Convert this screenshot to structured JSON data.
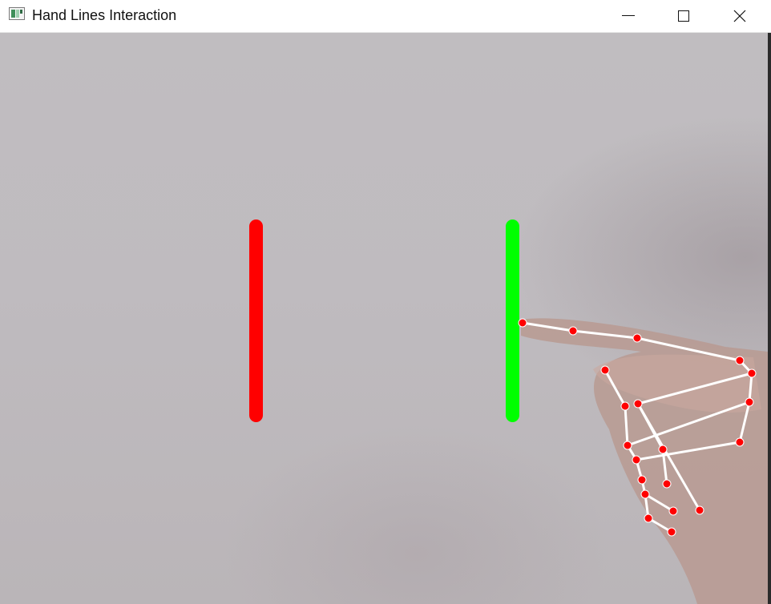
{
  "window": {
    "title": "Hand Lines Interaction",
    "icon": "app-window-icon",
    "controls": {
      "minimize_icon": "minimize-icon",
      "maximize_icon": "maximize-icon",
      "close_icon": "close-icon"
    }
  },
  "scene": {
    "lines": [
      {
        "name": "left-line",
        "color": "#ff0000",
        "state": "inactive"
      },
      {
        "name": "right-line",
        "color": "#00ff00",
        "state": "touched"
      }
    ],
    "landmarks": {
      "point_color": "#ff0000",
      "connection_color": "#ffffff",
      "count": 21
    }
  }
}
